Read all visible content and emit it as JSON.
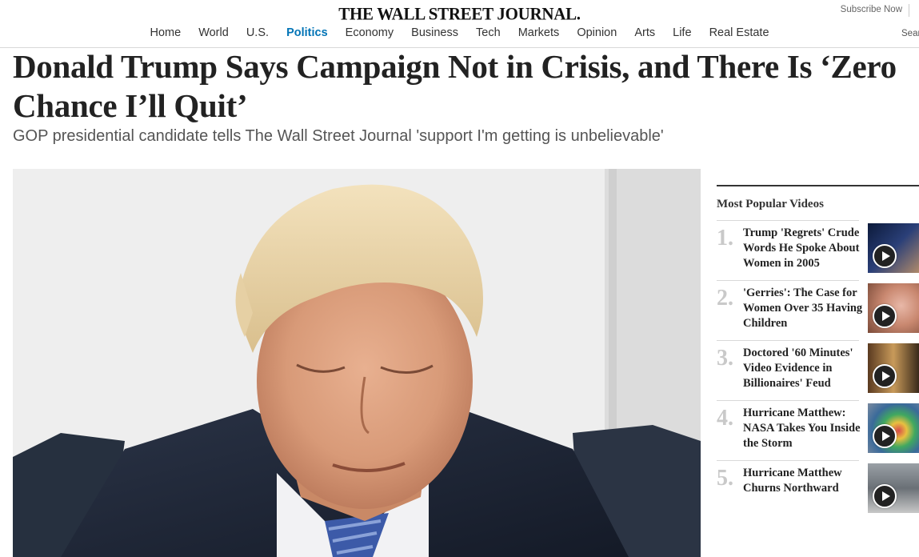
{
  "header": {
    "logo": "THE WALL STREET JOURNAL.",
    "subscribe": "Subscribe Now",
    "search": "Search",
    "nav": [
      "Home",
      "World",
      "U.S.",
      "Politics",
      "Economy",
      "Business",
      "Tech",
      "Markets",
      "Opinion",
      "Arts",
      "Life",
      "Real Estate"
    ],
    "active_nav": "Politics",
    "accent_color": "#0274b6"
  },
  "article": {
    "headline": "Donald Trump Says Campaign Not in Crisis, and There Is ‘Zero Chance I’ll Quit’",
    "dek": "GOP presidential candidate tells The Wall Street Journal 'support I'm getting is unbelievable'"
  },
  "sidebar": {
    "title": "Most Popular Videos",
    "videos": [
      {
        "num": "1.",
        "title": "Trump 'Regrets' Crude Words He Spoke About Women in 2005"
      },
      {
        "num": "2.",
        "title": "'Gerries': The Case for Women Over 35 Having Children"
      },
      {
        "num": "3.",
        "title": "Doctored '60 Minutes' Video Evidence in Billionaires' Feud"
      },
      {
        "num": "4.",
        "title": "Hurricane Matthew: NASA Takes You Inside the Storm"
      },
      {
        "num": "5.",
        "title": "Hurricane Matthew Churns Northward"
      }
    ]
  }
}
